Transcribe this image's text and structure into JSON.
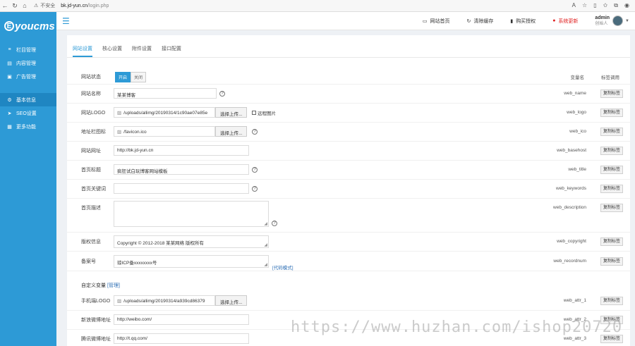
{
  "browser": {
    "insecure_label": "不安全",
    "url_host": "bk.jd-yun.cn",
    "url_path": "/login.php"
  },
  "sidebar": {
    "logo_text": "youcms",
    "logo_letter": "E",
    "items_top": [
      {
        "label": "栏目管理",
        "icon": "list-icon"
      },
      {
        "label": "内容管理",
        "icon": "document-icon"
      },
      {
        "label": "广告管理",
        "icon": "ad-icon"
      }
    ],
    "items_bottom": [
      {
        "label": "基本信息",
        "icon": "gear-icon"
      },
      {
        "label": "SEO设置",
        "icon": "send-icon"
      },
      {
        "label": "更多功能",
        "icon": "grid-icon"
      }
    ]
  },
  "header": {
    "links": [
      {
        "label": "网站首页",
        "icon": "monitor-icon"
      },
      {
        "label": "清除缓存",
        "icon": "refresh-icon"
      },
      {
        "label": "购买授权",
        "icon": "bookmark-icon"
      },
      {
        "label": "系统更新",
        "icon": "alert-icon"
      }
    ],
    "user_name": "admin",
    "user_role": "创始人"
  },
  "tabs": [
    "网站设置",
    "核心设置",
    "附件设置",
    "接口配置"
  ],
  "columns": {
    "var": "变量名",
    "tag": "标签调用"
  },
  "toggle": {
    "on": "开启",
    "off": "关闭"
  },
  "copy_label": "复制标签",
  "fields": {
    "status": {
      "label": "网站状态"
    },
    "name": {
      "label": "网站名称",
      "value": "某某博客",
      "var": "web_name"
    },
    "logo": {
      "label": "网站LOGO",
      "value": "/uploads/allimg/20190314/1c90ae07e85e",
      "button": "选择上传...",
      "remote": "远程图片",
      "var": "web_logo"
    },
    "ico": {
      "label": "地址栏图标",
      "value": "/favicon.ico",
      "button": "选择上传...",
      "var": "web_ico"
    },
    "url": {
      "label": "网站网址",
      "value": "http://bk.jd-yun.cn",
      "var": "web_basehost"
    },
    "title": {
      "label": "首页标题",
      "value": "疯狂试白玩博客网站模板",
      "var": "web_title"
    },
    "keywords": {
      "label": "首页关键词",
      "value": "",
      "var": "web_keywords"
    },
    "description": {
      "label": "首页描述",
      "value": "",
      "var": "web_description"
    },
    "copyright": {
      "label": "版权信息",
      "value": "Copyright © 2012-2018 某某网络 版权所有",
      "var": "web_copyright"
    },
    "recordnum": {
      "label": "备案号",
      "value": "琼ICP备xxxxxxxx号",
      "link": "[代码模式]",
      "var": "web_recordnum"
    }
  },
  "custom": {
    "title": "自定义变量",
    "manage": "[管理]",
    "items": [
      {
        "label": "手机端LOGO",
        "value": "/uploads/allimg/20190314/a939cd86379",
        "button": "选择上传...",
        "var": "web_attr_1"
      },
      {
        "label": "新浪微博地址",
        "value": "http://weibo.com/",
        "var": "web_attr_2"
      },
      {
        "label": "腾讯微博地址",
        "value": "http://t.qq.com/",
        "var": "web_attr_3"
      }
    ]
  },
  "watermark": "https://www.huzhan.com/ishop20720",
  "colors": {
    "accent": "#2d9ad6",
    "alert": "#e02020"
  }
}
